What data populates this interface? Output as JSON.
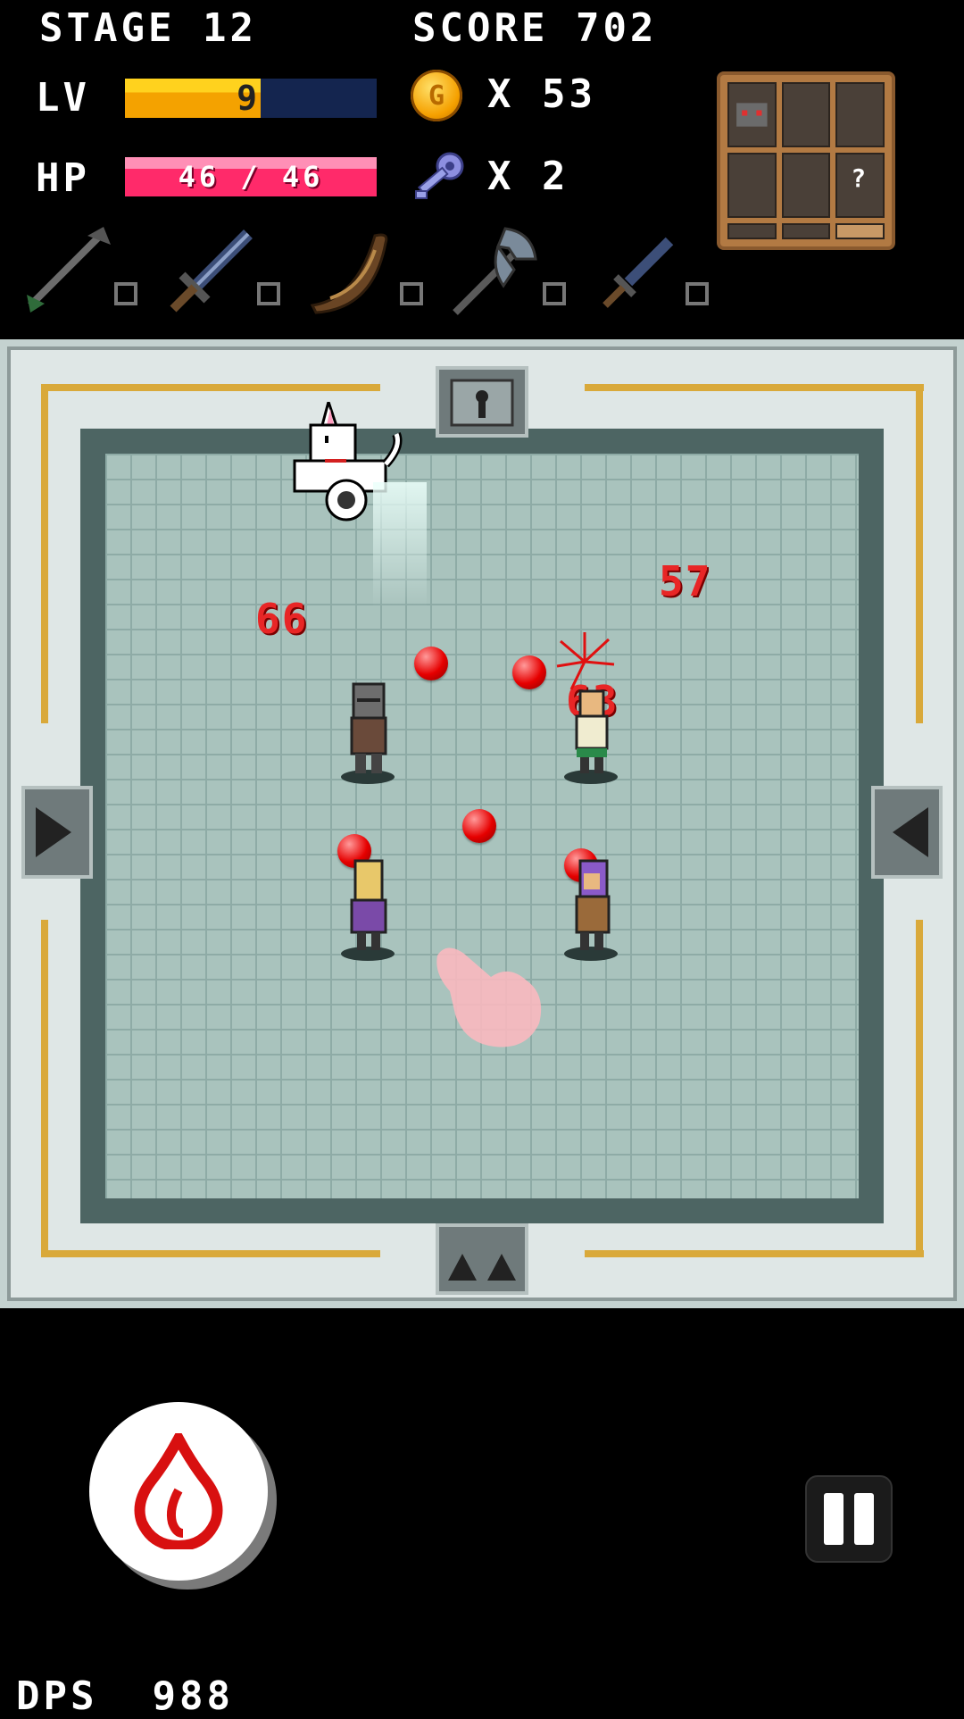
{
  "hud": {
    "stage_label": "STAGE",
    "stage_value": "12",
    "score_label": "SCORE",
    "score_value": "702",
    "lv_label": "LV",
    "lv_value": "9",
    "lv_progress": 0.54,
    "hp_label": "HP",
    "hp_text": "46 / 46",
    "hp_current": 46,
    "hp_max": 46,
    "coin_glyph": "G",
    "coin_count": "X 53",
    "key_count": "X 2"
  },
  "inventory": {
    "slots": [
      "",
      "",
      "",
      "",
      "",
      "?",
      "",
      "",
      ""
    ]
  },
  "weapons": [
    "arrow-icon",
    "sword-icon",
    "boomerang-icon",
    "battle-axe-icon",
    "dagger-icon"
  ],
  "arena": {
    "damage_numbers": [
      "66",
      "57",
      "63"
    ]
  },
  "controls": {
    "fire_icon": "fire-icon",
    "pause_icon": "pause-icon"
  },
  "footer": {
    "dps_label": "DPS",
    "dps_value": "988"
  },
  "colors": {
    "lv_fill": "#f4a200",
    "hp_fill": "#ff2a6a",
    "damage": "#e82626"
  }
}
